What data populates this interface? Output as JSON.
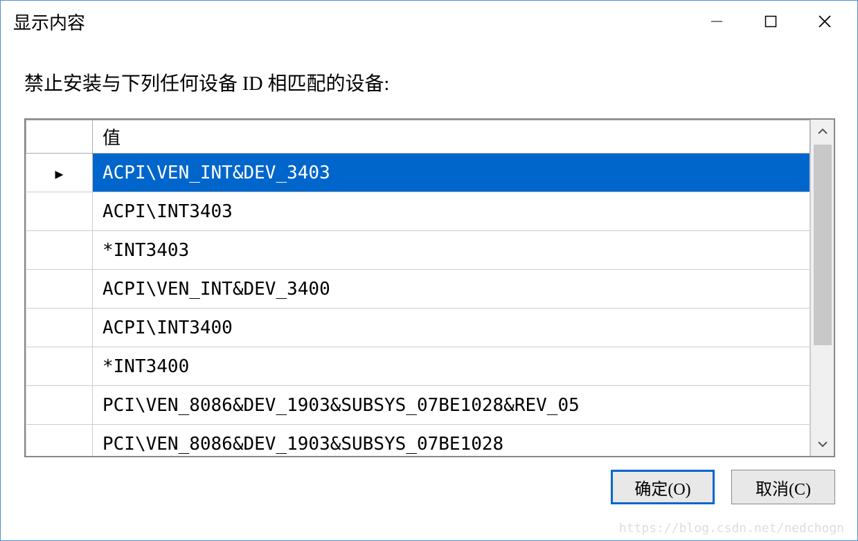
{
  "window": {
    "title": "显示内容"
  },
  "instruction": "禁止安装与下列任何设备 ID 相匹配的设备:",
  "grid": {
    "header": {
      "indicator": "",
      "value_col": "值"
    },
    "rows": [
      {
        "value": "ACPI\\VEN_INT&DEV_3403",
        "selected": true
      },
      {
        "value": "ACPI\\INT3403",
        "selected": false
      },
      {
        "value": "*INT3403",
        "selected": false
      },
      {
        "value": "ACPI\\VEN_INT&DEV_3400",
        "selected": false
      },
      {
        "value": "ACPI\\INT3400",
        "selected": false
      },
      {
        "value": "*INT3400",
        "selected": false
      },
      {
        "value": "PCI\\VEN_8086&DEV_1903&SUBSYS_07BE1028&REV_05",
        "selected": false
      },
      {
        "value": "PCI\\VEN_8086&DEV_1903&SUBSYS_07BE1028",
        "selected": false
      }
    ]
  },
  "buttons": {
    "ok": "确定(O)",
    "cancel": "取消(C)"
  },
  "watermark": "https://blog.csdn.net/nedchogn"
}
